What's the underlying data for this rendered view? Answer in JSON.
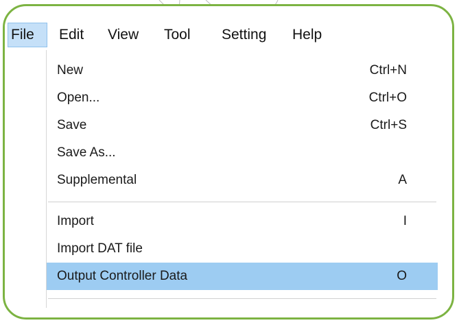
{
  "menubar": {
    "items": [
      {
        "label": "File",
        "active": true
      },
      {
        "label": "Edit"
      },
      {
        "label": "View"
      },
      {
        "label": "Tool"
      },
      {
        "label": "Setting"
      },
      {
        "label": "Help"
      }
    ]
  },
  "file_menu": {
    "items": [
      {
        "label": "New",
        "shortcut": "Ctrl+N"
      },
      {
        "label": "Open...",
        "shortcut": "Ctrl+O"
      },
      {
        "label": "Save",
        "shortcut": "Ctrl+S"
      },
      {
        "label": "Save As...",
        "shortcut": ""
      },
      {
        "label": "Supplemental",
        "shortcut": "A"
      },
      {
        "label": "Import",
        "shortcut": "I"
      },
      {
        "label": "Import DAT file",
        "shortcut": ""
      },
      {
        "label": "Output Controller Data",
        "shortcut": "O",
        "highlighted": true
      }
    ]
  },
  "colors": {
    "frame_border": "#7cb342",
    "menu_highlight": "#9dccf2",
    "active_menu_bg": "#c5e0f8"
  }
}
